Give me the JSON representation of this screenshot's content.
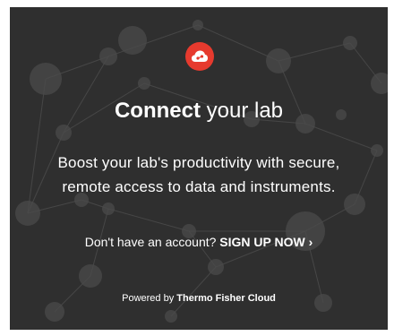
{
  "hero": {
    "logo_icon": "cloud-icon",
    "title_strong": "Connect",
    "title_rest": " your lab",
    "tagline_line1": "Boost your lab's productivity with secure,",
    "tagline_line2": "remote access to data and instruments."
  },
  "signup": {
    "prompt": "Don't have an account?",
    "link_label": "SIGN UP NOW ›"
  },
  "footer": {
    "powered_prefix": "Powered by",
    "brand": "Thermo Fisher Cloud"
  },
  "colors": {
    "background": "#2f2f2f",
    "accent": "#e63a2e",
    "text": "#ffffff"
  }
}
